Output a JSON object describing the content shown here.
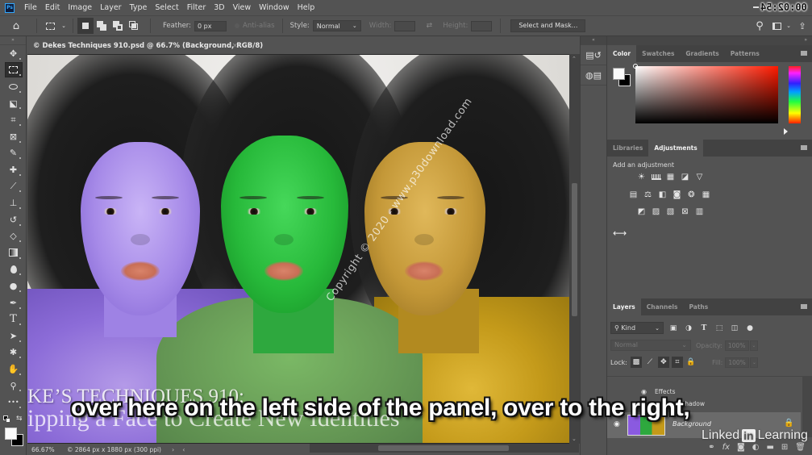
{
  "app": {
    "name": "Photoshop",
    "logo": "Ps",
    "timestamp": "00:02:54"
  },
  "menu": [
    "File",
    "Edit",
    "Image",
    "Layer",
    "Type",
    "Select",
    "Filter",
    "3D",
    "View",
    "Window",
    "Help"
  ],
  "options_bar": {
    "feather_label": "Feather:",
    "feather_value": "0 px",
    "antialias_label": "Anti-alias",
    "style_label": "Style:",
    "style_value": "Normal",
    "width_label": "Width:",
    "height_label": "Height:",
    "select_and_mask": "Select and Mask..."
  },
  "toolbar": {
    "tools": [
      {
        "name": "move",
        "glyph": "✥"
      },
      {
        "name": "rectangular-marquee",
        "glyph": "⬚",
        "active": true
      },
      {
        "name": "lasso",
        "glyph": "ᑕ"
      },
      {
        "name": "object-selection",
        "glyph": "⬕"
      },
      {
        "name": "crop",
        "glyph": "⌗"
      },
      {
        "name": "frame",
        "glyph": "⊠"
      },
      {
        "name": "eyedropper",
        "glyph": "✎"
      },
      {
        "name": "healing-brush",
        "glyph": "✚"
      },
      {
        "name": "brush",
        "glyph": "🖌"
      },
      {
        "name": "clone-stamp",
        "glyph": "⊥"
      },
      {
        "name": "history-brush",
        "glyph": "↺"
      },
      {
        "name": "eraser",
        "glyph": "◇"
      },
      {
        "name": "gradient",
        "glyph": "▮"
      },
      {
        "name": "blur",
        "glyph": "💧"
      },
      {
        "name": "dodge",
        "glyph": "●"
      },
      {
        "name": "pen",
        "glyph": "✒"
      },
      {
        "name": "type",
        "glyph": "T"
      },
      {
        "name": "path-selection",
        "glyph": "➤"
      },
      {
        "name": "custom-shape",
        "glyph": "✱"
      },
      {
        "name": "hand",
        "glyph": "✋"
      },
      {
        "name": "zoom",
        "glyph": "⚲"
      },
      {
        "name": "edit-toolbar",
        "glyph": "•••"
      }
    ]
  },
  "document": {
    "tab_title": "© Dekes Techniques 910.psd @ 66.7% (Background, RGB/8)",
    "close_glyph": "×",
    "watermark": "Copyright © 2020 - www.p30download.com",
    "title_line1": "KE’S TECHNIQUES 910:",
    "title_line2": "ipping a Face to Create New Identities",
    "zoom_level": "66.67%",
    "doc_info": "© 2864 px x 1880 px (300 ppi)",
    "status_arrow_right": "›",
    "status_arrow_left": "‹"
  },
  "caption": "over here on the left side of the panel, over to the right,",
  "color_panel": {
    "tabs": [
      "Color",
      "Swatches",
      "Gradients",
      "Patterns"
    ],
    "active_tab": "Color",
    "foreground": "#fafafa",
    "background": "#000000",
    "hue_color": "#ff1a00"
  },
  "adjustments_panel": {
    "tabs": [
      "Libraries",
      "Adjustments"
    ],
    "active_tab": "Adjustments",
    "label": "Add an adjustment",
    "rows": [
      [
        {
          "name": "brightness-contrast",
          "glyph": "☀"
        },
        {
          "name": "levels",
          "glyph": "▂"
        },
        {
          "name": "curves",
          "glyph": "▦"
        },
        {
          "name": "exposure",
          "glyph": "◪"
        },
        {
          "name": "vibrance",
          "glyph": "▽"
        }
      ],
      [
        {
          "name": "hue-saturation",
          "glyph": "▤"
        },
        {
          "name": "color-balance",
          "glyph": "⚖"
        },
        {
          "name": "black-white",
          "glyph": "◧"
        },
        {
          "name": "photo-filter",
          "glyph": "◙"
        },
        {
          "name": "channel-mixer",
          "glyph": "❂"
        },
        {
          "name": "color-lookup",
          "glyph": "▦"
        }
      ],
      [
        {
          "name": "invert",
          "glyph": "◩"
        },
        {
          "name": "posterize",
          "glyph": "▨"
        },
        {
          "name": "threshold",
          "glyph": "▧"
        },
        {
          "name": "selective-color",
          "glyph": "⊠"
        },
        {
          "name": "gradient-map",
          "glyph": "▥"
        }
      ]
    ],
    "expand_glyph": "⟷"
  },
  "layers_panel": {
    "tabs": [
      "Layers",
      "Channels",
      "Paths"
    ],
    "active_tab": "Layers",
    "filter_kind": "Kind",
    "blend_mode": "Normal",
    "opacity_label": "Opacity:",
    "opacity_value": "100%",
    "lock_label": "Lock:",
    "fill_label": "Fill:",
    "fill_value": "100%",
    "effects_label": "Effects",
    "drop_shadow_label": "Drop Shadow",
    "background_layer_name": "Background"
  },
  "branding": {
    "linkedin_pre": "Linked",
    "linkedin_in": "in",
    "linkedin_post": "Learning"
  }
}
